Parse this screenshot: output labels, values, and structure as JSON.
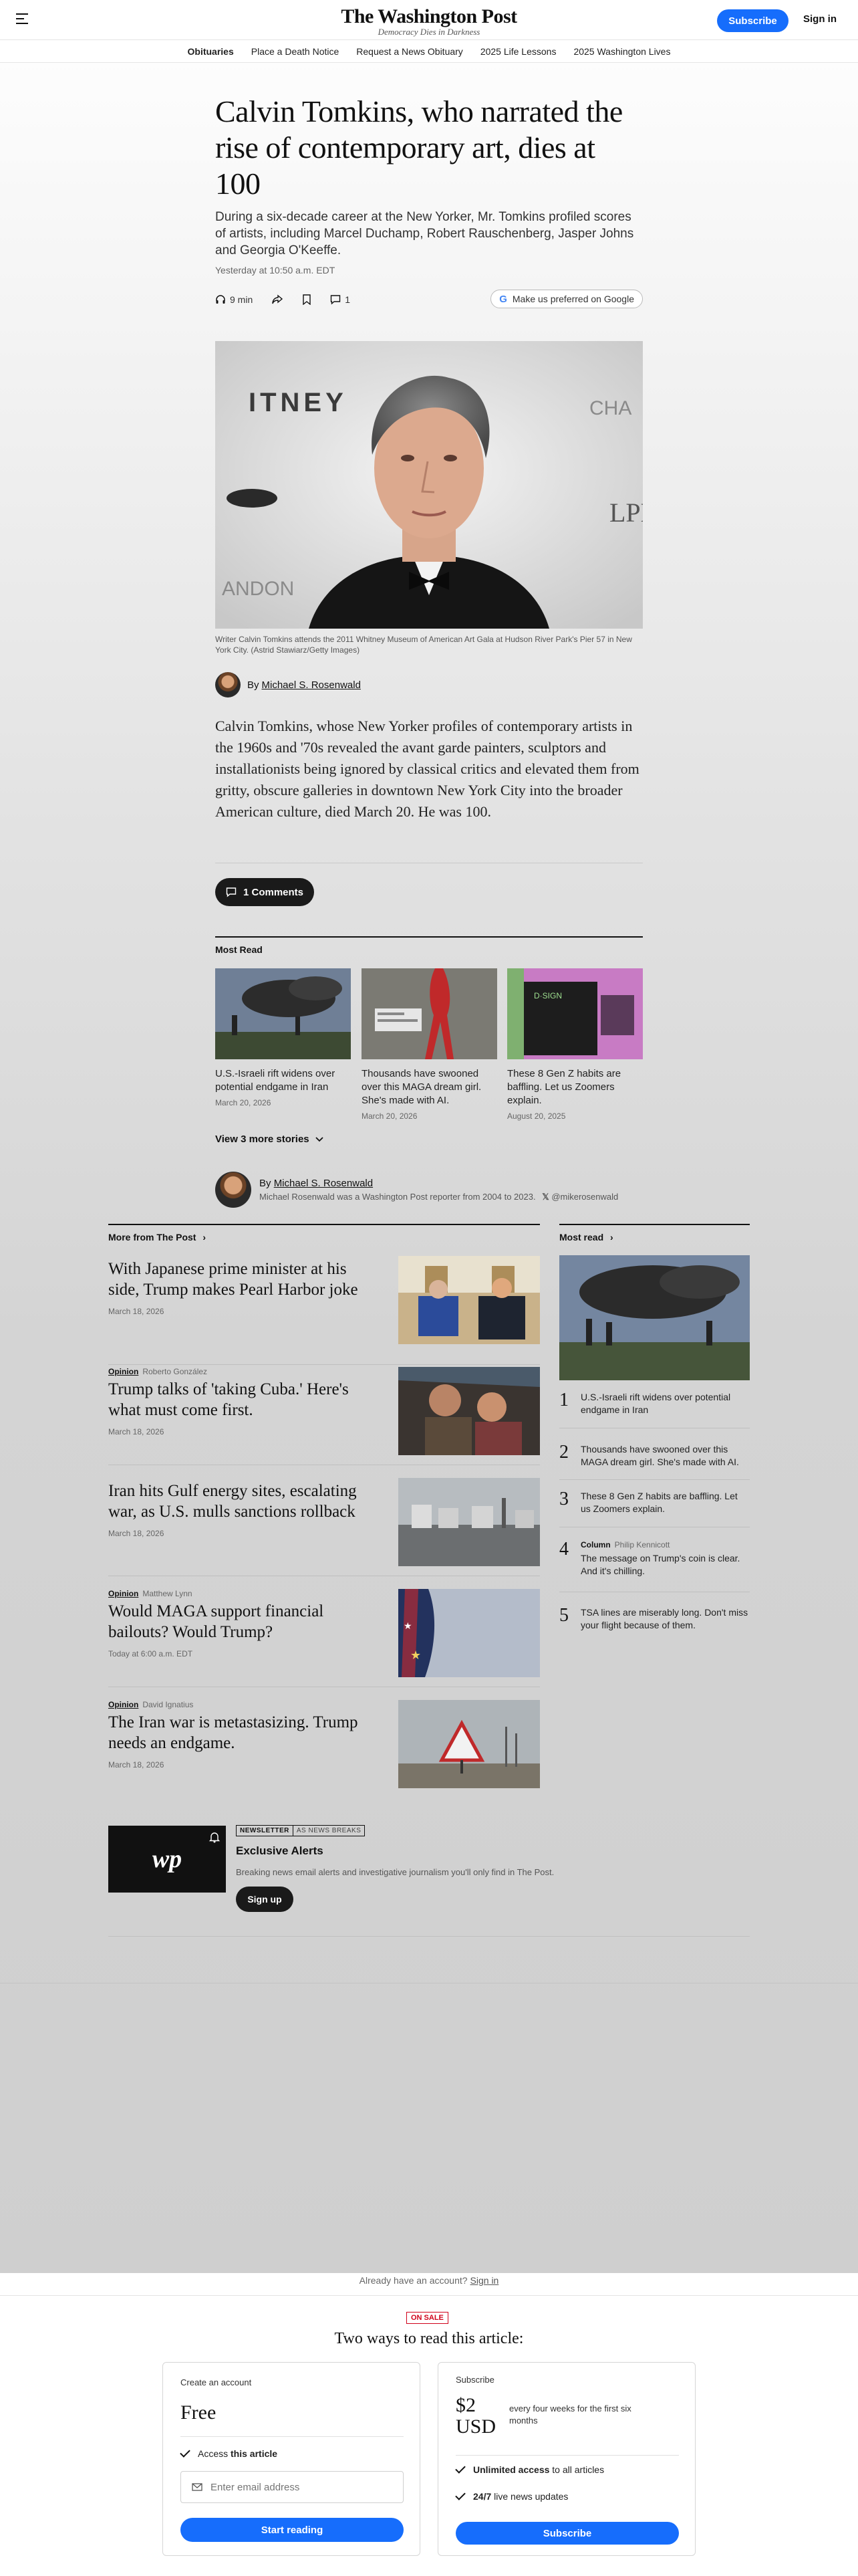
{
  "header": {
    "logo_name": "The Washington Post",
    "logo_tagline": "Democracy Dies in Darkness",
    "subscribe_label": "Subscribe",
    "signin_label": "Sign in"
  },
  "nav": {
    "items": [
      {
        "label": "Obituaries",
        "active": true
      },
      {
        "label": "Place a Death Notice"
      },
      {
        "label": "Request a News Obituary"
      },
      {
        "label": "2025 Life Lessons"
      },
      {
        "label": "2025 Washington Lives"
      }
    ]
  },
  "article": {
    "headline": "Calvin Tomkins, who narrated the rise of contemporary art, dies at 100",
    "dek": "During a six-decade career at the New Yorker, Mr. Tomkins profiled scores of artists, including Marcel Duchamp, Robert Rauschenberg, Jasper Johns and Georgia O'Keeffe.",
    "timestamp": "Yesterday at 10:50 a.m. EDT",
    "listen_time": "9 min",
    "comment_count": "1",
    "google_label": "Make us preferred on Google",
    "caption": "Writer Calvin Tomkins attends the 2011 Whitney Museum of American Art Gala at Hudson River Park's Pier 57 in New York City. (Astrid Stawiarz/Getty Images)",
    "byline_prefix": "By",
    "author": "Michael S. Rosenwald",
    "lede": "Calvin Tomkins, whose New Yorker profiles of contemporary artists in the 1960s and '70s revealed the avant garde painters, sculptors and installationists being ignored by classical critics and elevated them from gritty, obscure galleries in downtown New York City into the broader American culture, died March 20. He was 100.",
    "comments_button": "1 Comments"
  },
  "most_read_inline": {
    "label": "Most Read",
    "items": [
      {
        "title": "U.S.-Israeli rift widens over potential endgame in Iran",
        "date": "March 20, 2026"
      },
      {
        "title": "Thousands have swooned over this MAGA dream girl. She's made with AI.",
        "date": "March 20, 2026"
      },
      {
        "title": "These 8 Gen Z habits are baffling. Let us Zoomers explain.",
        "date": "August 20, 2025"
      }
    ],
    "view_more": "View 3 more stories"
  },
  "author_box": {
    "by": "By",
    "name": "Michael S. Rosenwald",
    "bio": "Michael Rosenwald was a Washington Post reporter from 2004 to 2023.",
    "handle": "@mikerosenwald"
  },
  "more_from": {
    "label": "More from The Post",
    "stories": [
      {
        "opinion": "",
        "author": "",
        "title": "With Japanese prime minister at his side, Trump makes Pearl Harbor joke",
        "date": "March 18, 2026"
      },
      {
        "opinion": "Opinion",
        "author": "Roberto González",
        "title": "Trump talks of 'taking Cuba.' Here's what must come first.",
        "date": "March 18, 2026"
      },
      {
        "opinion": "",
        "author": "",
        "title": "Iran hits Gulf energy sites, escalating war, as U.S. mulls sanctions rollback",
        "date": "March 18, 2026"
      },
      {
        "opinion": "Opinion",
        "author": "Matthew Lynn",
        "title": "Would MAGA support financial bailouts? Would Trump?",
        "date": "Today at 6:00 a.m. EDT"
      },
      {
        "opinion": "Opinion",
        "author": "David Ignatius",
        "title": "The Iran war is metastasizing. Trump needs an endgame.",
        "date": "March 18, 2026"
      }
    ]
  },
  "rail": {
    "label": "Most read",
    "items": [
      {
        "num": "1",
        "column": "",
        "author": "",
        "title": "U.S.-Israeli rift widens over potential endgame in Iran"
      },
      {
        "num": "2",
        "column": "",
        "author": "",
        "title": "Thousands have swooned over this MAGA dream girl. She's made with AI."
      },
      {
        "num": "3",
        "column": "",
        "author": "",
        "title": "These 8 Gen Z habits are baffling. Let us Zoomers explain."
      },
      {
        "num": "4",
        "column": "Column",
        "author": "Philip Kennicott",
        "title": "The message on Trump's coin is clear. And it's chilling."
      },
      {
        "num": "5",
        "column": "",
        "author": "",
        "title": "TSA lines are miserably long. Don't miss your flight because of them."
      }
    ]
  },
  "newsletter": {
    "logo": "wp",
    "tag_newsletter": "NEWSLETTER",
    "tag_frequency": "AS NEWS BREAKS",
    "title": "Exclusive Alerts",
    "desc": "Breaking news email alerts and investigative journalism you'll only find in The Post.",
    "button": "Sign up"
  },
  "paywall": {
    "account_prompt": "Already have an account?",
    "signin_link": "Sign in",
    "sale_badge": "ON SALE",
    "title": "Two ways to read this article:",
    "free_plan": {
      "label": "Create an account",
      "price": "Free",
      "feature_prefix": "Access",
      "feature_bold": "this article",
      "email_placeholder": "Enter email address",
      "button": "Start reading"
    },
    "paid_plan": {
      "label": "Subscribe",
      "price_line1": "$2",
      "price_line2": "USD",
      "price_note": "every four weeks for the first six months",
      "feature1_bold": "Unlimited access",
      "feature1_rest": "to all articles",
      "feature2_bold": "24/7",
      "feature2_rest": "live news updates",
      "button": "Subscribe"
    }
  },
  "colors": {
    "accent_blue": "#166dfc",
    "sale_red": "#d0021b"
  }
}
